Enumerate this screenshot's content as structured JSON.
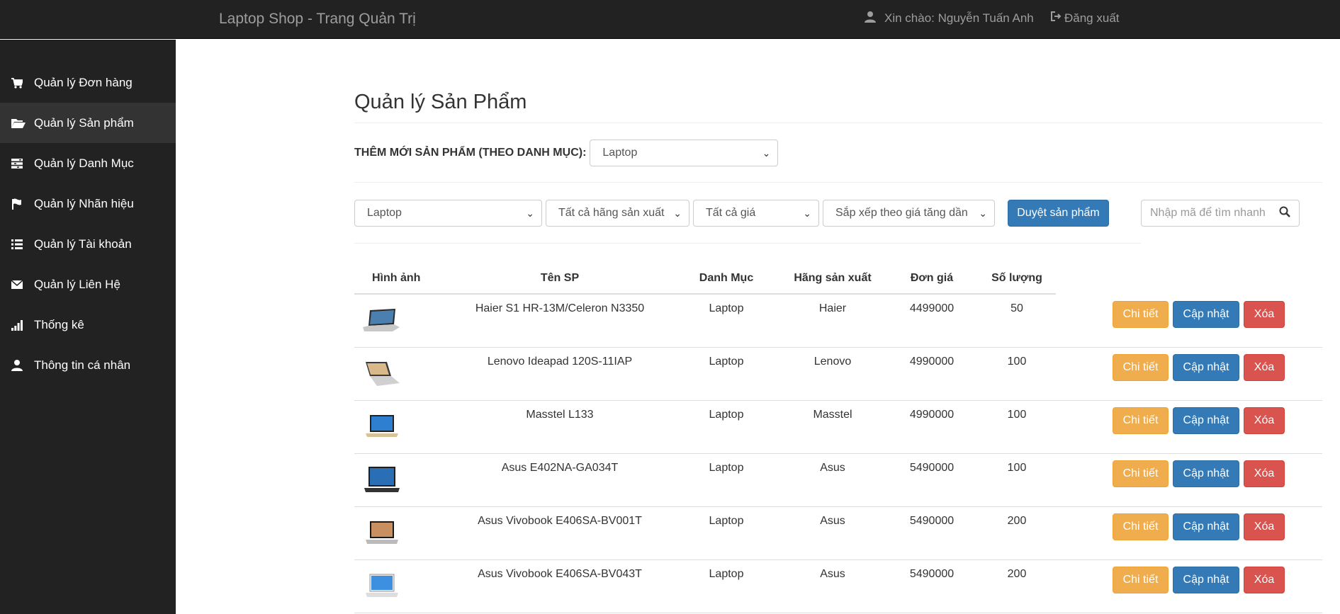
{
  "navbar": {
    "brand": "Laptop Shop - Trang Quản Trị",
    "greeting": "Xin chào: Nguyễn Tuấn Anh",
    "logout": "Đăng xuất",
    "user_icon": "user-icon",
    "logout_icon": "logout-icon"
  },
  "sidebar": {
    "items": [
      {
        "label": "Quản lý Đơn hàng",
        "icon": "cart-icon"
      },
      {
        "label": "Quản lý Sản phẩm",
        "icon": "folder-open-icon",
        "active": true
      },
      {
        "label": "Quản lý Danh Mục",
        "icon": "tasks-icon"
      },
      {
        "label": "Quản lý Nhãn hiệu",
        "icon": "flag-icon"
      },
      {
        "label": "Quản lý Tài khoản",
        "icon": "list-icon"
      },
      {
        "label": "Quản lý Liên Hệ",
        "icon": "envelope-icon"
      },
      {
        "label": "Thống kê",
        "icon": "signal-icon"
      },
      {
        "label": "Thông tin cá nhân",
        "icon": "user-icon"
      }
    ]
  },
  "main": {
    "title": "Quản lý Sản Phẩm",
    "add_label": "THÊM MỚI SẢN PHẨM (THEO DANH MỤC):",
    "add_category_selected": "Laptop",
    "filters": {
      "category": "Laptop",
      "brand": "Tất cả hãng sản xuất",
      "price": "Tất cả giá",
      "sort": "Sắp xếp theo giá tăng dần",
      "browse_button": "Duyệt sản phẩm"
    },
    "search": {
      "placeholder": "Nhập mã để tìm nhanh"
    },
    "table": {
      "headers": [
        "Hình ảnh",
        "Tên SP",
        "Danh Mục",
        "Hãng sản xuất",
        "Đơn giá",
        "Số lượng"
      ],
      "action_labels": {
        "detail": "Chi tiết",
        "update": "Cập nhật",
        "delete": "Xóa"
      },
      "rows": [
        {
          "name": "Haier S1 HR-13M/Celeron N3350",
          "category": "Laptop",
          "brand": "Haier",
          "price": "4499000",
          "qty": "50"
        },
        {
          "name": "Lenovo Ideapad 120S-11IAP",
          "category": "Laptop",
          "brand": "Lenovo",
          "price": "4990000",
          "qty": "100"
        },
        {
          "name": "Masstel L133",
          "category": "Laptop",
          "brand": "Masstel",
          "price": "4990000",
          "qty": "100"
        },
        {
          "name": "Asus E402NA-GA034T",
          "category": "Laptop",
          "brand": "Asus",
          "price": "5490000",
          "qty": "100"
        },
        {
          "name": "Asus Vivobook E406SA-BV001T",
          "category": "Laptop",
          "brand": "Asus",
          "price": "5490000",
          "qty": "200"
        },
        {
          "name": "Asus Vivobook E406SA-BV043T",
          "category": "Laptop",
          "brand": "Asus",
          "price": "5490000",
          "qty": "200"
        }
      ]
    }
  },
  "colors": {
    "navbar_bg": "#222222",
    "primary": "#337ab7",
    "warning": "#f0ad4e",
    "danger": "#d9534f"
  }
}
